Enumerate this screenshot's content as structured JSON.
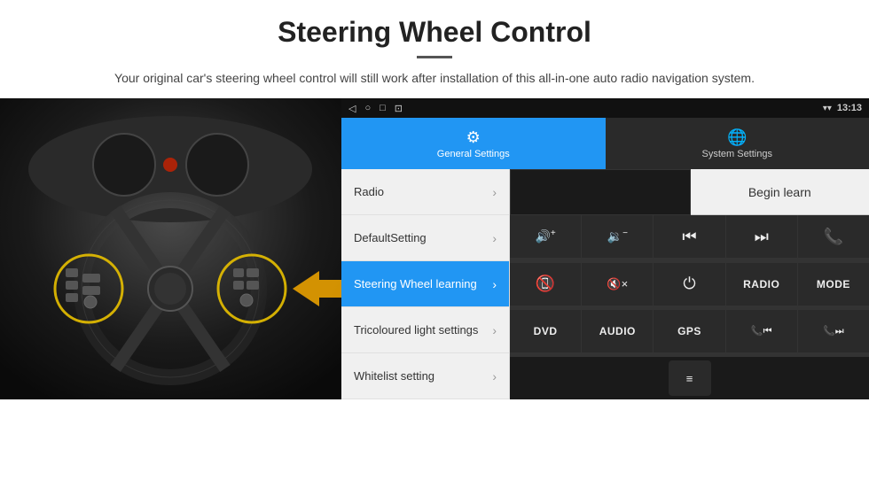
{
  "header": {
    "title": "Steering Wheel Control",
    "divider": true,
    "subtitle": "Your original car's steering wheel control will still work after installation of this all-in-one auto radio navigation system."
  },
  "status_bar": {
    "time": "13:13",
    "back_icon": "◁",
    "home_icon": "○",
    "square_icon": "□",
    "signal_icon": "▾",
    "wifi_icon": "▾"
  },
  "tabs": [
    {
      "id": "general",
      "label": "General Settings",
      "icon": "⚙",
      "active": true
    },
    {
      "id": "system",
      "label": "System Settings",
      "icon": "🌐",
      "active": false
    }
  ],
  "menu_items": [
    {
      "id": "radio",
      "label": "Radio",
      "active": false
    },
    {
      "id": "default",
      "label": "DefaultSetting",
      "active": false
    },
    {
      "id": "steering",
      "label": "Steering Wheel learning",
      "active": true
    },
    {
      "id": "tricoloured",
      "label": "Tricoloured light settings",
      "active": false
    },
    {
      "id": "whitelist",
      "label": "Whitelist setting",
      "active": false
    }
  ],
  "begin_learn_label": "Begin learn",
  "control_buttons": [
    {
      "id": "vol-up",
      "type": "icon",
      "icon": "🔊+",
      "symbol": "vol+"
    },
    {
      "id": "vol-down",
      "type": "icon",
      "icon": "🔉−",
      "symbol": "vol-"
    },
    {
      "id": "prev-track",
      "type": "icon",
      "symbol": "⏮"
    },
    {
      "id": "next-track",
      "type": "icon",
      "symbol": "⏭"
    },
    {
      "id": "phone",
      "type": "icon",
      "symbol": "📞"
    },
    {
      "id": "hang-up",
      "type": "icon",
      "symbol": "📵"
    },
    {
      "id": "mute-x",
      "type": "icon",
      "symbol": "🔇×"
    },
    {
      "id": "power",
      "type": "icon",
      "symbol": "⏻"
    },
    {
      "id": "radio-btn",
      "type": "text",
      "label": "RADIO"
    },
    {
      "id": "mode-btn",
      "type": "text",
      "label": "MODE"
    },
    {
      "id": "dvd-btn",
      "type": "text",
      "label": "DVD"
    },
    {
      "id": "audio-btn",
      "type": "text",
      "label": "AUDIO"
    },
    {
      "id": "gps-btn",
      "type": "text",
      "label": "GPS"
    },
    {
      "id": "tel-prev",
      "type": "icon",
      "symbol": "📞⏮"
    },
    {
      "id": "tel-next",
      "type": "icon",
      "symbol": "📞⏭"
    },
    {
      "id": "list-btn",
      "type": "icon",
      "symbol": "≡"
    }
  ],
  "colors": {
    "active_tab": "#2196F3",
    "active_menu": "#2196F3",
    "dark_bg": "#1a1a1a",
    "light_bg": "#f0f0f0"
  }
}
